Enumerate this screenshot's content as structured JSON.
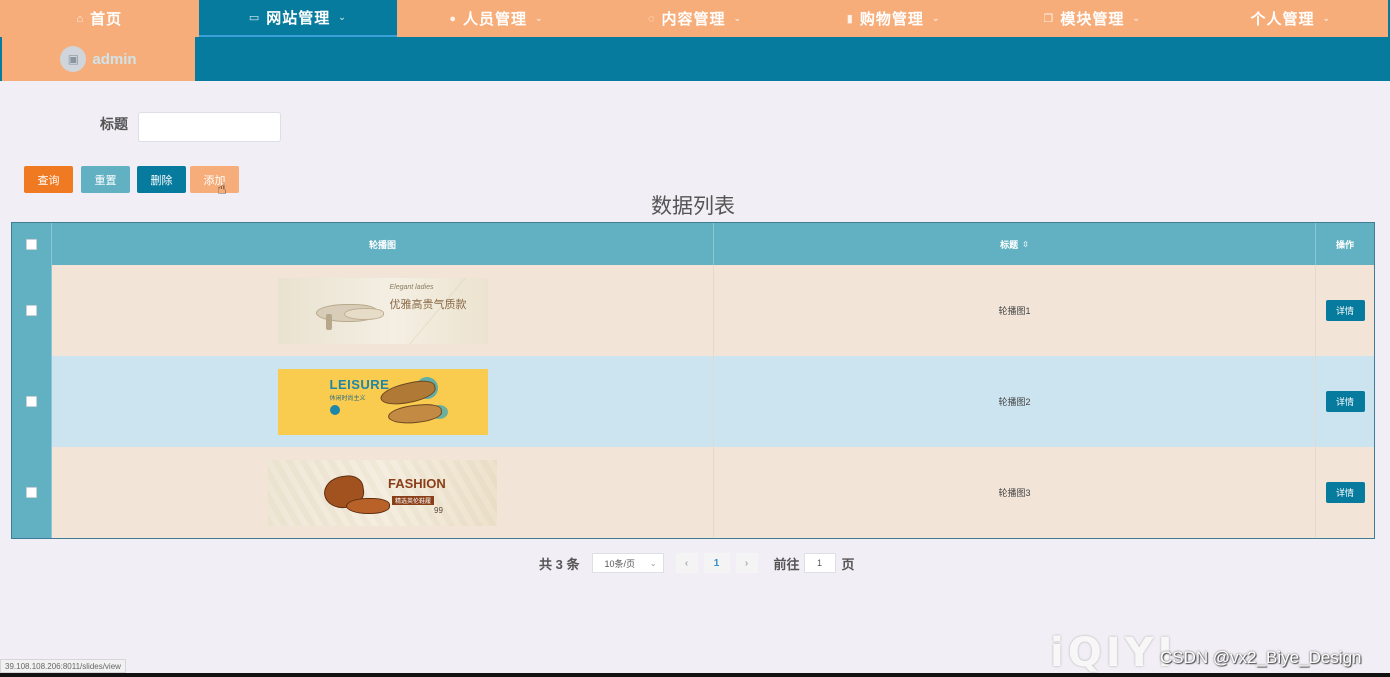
{
  "nav": {
    "items": [
      {
        "label": "首页",
        "icon": "home-icon"
      },
      {
        "label": "网站管理",
        "icon": "monitor-icon"
      },
      {
        "label": "人员管理",
        "icon": "user-icon"
      },
      {
        "label": "内容管理",
        "icon": "chat-icon"
      },
      {
        "label": "购物管理",
        "icon": "bag-icon"
      },
      {
        "label": "模块管理",
        "icon": "copy-icon"
      },
      {
        "label": "个人管理",
        "icon": ""
      }
    ],
    "active": "网站管理",
    "user": "admin"
  },
  "search": {
    "title_label": "标题",
    "title_value": ""
  },
  "buttons": {
    "query": "查询",
    "reset": "重置",
    "delete": "删除",
    "add": "添加"
  },
  "list_title": "数据列表",
  "table": {
    "headers": {
      "image": "轮播图",
      "title": "标题",
      "operation": "操作"
    },
    "rows": [
      {
        "title": "轮播图1",
        "action": "详情",
        "banner_text": "优雅高贵气质款",
        "banner_top": "Elegant ladies"
      },
      {
        "title": "轮播图2",
        "action": "详情",
        "banner_text": "LEISURE",
        "banner_sub": "休闲时尚主义"
      },
      {
        "title": "轮播图3",
        "action": "详情",
        "banner_text": "FASHION",
        "banner_sub": "精选英伦鞋履",
        "banner_price": "99"
      }
    ]
  },
  "pagination": {
    "total_prefix": "共",
    "total": "3",
    "total_suffix": "条",
    "page_size": "10条/页",
    "current_page": "1",
    "goto_label": "前往",
    "goto_value": "1",
    "goto_suffix": "页"
  },
  "status_url": "39.108.108.206:8011/slides/view",
  "watermark": {
    "logo": "iQIYI",
    "text": "CSDN @vx2_Biye_Design"
  },
  "colors": {
    "nav_orange": "#f7ad7a",
    "nav_teal": "#077b9d",
    "header_teal": "#62b1c3",
    "row_beige": "#f2e5d8",
    "row_blue": "#cce4f0",
    "btn_orange": "#ef7a22"
  }
}
